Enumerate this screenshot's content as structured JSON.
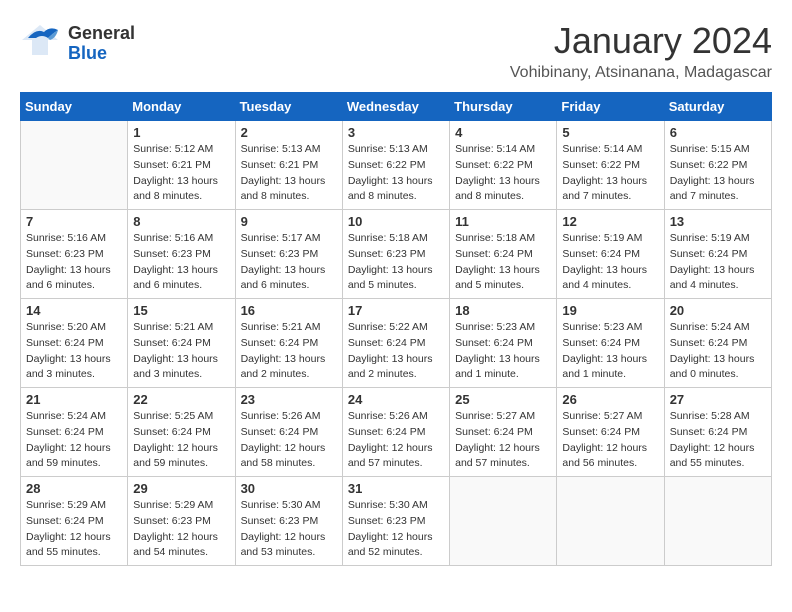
{
  "header": {
    "logo_general": "General",
    "logo_blue": "Blue",
    "month_year": "January 2024",
    "location": "Vohibinany, Atsinanana, Madagascar"
  },
  "weekdays": [
    "Sunday",
    "Monday",
    "Tuesday",
    "Wednesday",
    "Thursday",
    "Friday",
    "Saturday"
  ],
  "weeks": [
    [
      {
        "day": "",
        "info": ""
      },
      {
        "day": "1",
        "info": "Sunrise: 5:12 AM\nSunset: 6:21 PM\nDaylight: 13 hours\nand 8 minutes."
      },
      {
        "day": "2",
        "info": "Sunrise: 5:13 AM\nSunset: 6:21 PM\nDaylight: 13 hours\nand 8 minutes."
      },
      {
        "day": "3",
        "info": "Sunrise: 5:13 AM\nSunset: 6:22 PM\nDaylight: 13 hours\nand 8 minutes."
      },
      {
        "day": "4",
        "info": "Sunrise: 5:14 AM\nSunset: 6:22 PM\nDaylight: 13 hours\nand 8 minutes."
      },
      {
        "day": "5",
        "info": "Sunrise: 5:14 AM\nSunset: 6:22 PM\nDaylight: 13 hours\nand 7 minutes."
      },
      {
        "day": "6",
        "info": "Sunrise: 5:15 AM\nSunset: 6:22 PM\nDaylight: 13 hours\nand 7 minutes."
      }
    ],
    [
      {
        "day": "7",
        "info": "Sunrise: 5:16 AM\nSunset: 6:23 PM\nDaylight: 13 hours\nand 6 minutes."
      },
      {
        "day": "8",
        "info": "Sunrise: 5:16 AM\nSunset: 6:23 PM\nDaylight: 13 hours\nand 6 minutes."
      },
      {
        "day": "9",
        "info": "Sunrise: 5:17 AM\nSunset: 6:23 PM\nDaylight: 13 hours\nand 6 minutes."
      },
      {
        "day": "10",
        "info": "Sunrise: 5:18 AM\nSunset: 6:23 PM\nDaylight: 13 hours\nand 5 minutes."
      },
      {
        "day": "11",
        "info": "Sunrise: 5:18 AM\nSunset: 6:24 PM\nDaylight: 13 hours\nand 5 minutes."
      },
      {
        "day": "12",
        "info": "Sunrise: 5:19 AM\nSunset: 6:24 PM\nDaylight: 13 hours\nand 4 minutes."
      },
      {
        "day": "13",
        "info": "Sunrise: 5:19 AM\nSunset: 6:24 PM\nDaylight: 13 hours\nand 4 minutes."
      }
    ],
    [
      {
        "day": "14",
        "info": "Sunrise: 5:20 AM\nSunset: 6:24 PM\nDaylight: 13 hours\nand 3 minutes."
      },
      {
        "day": "15",
        "info": "Sunrise: 5:21 AM\nSunset: 6:24 PM\nDaylight: 13 hours\nand 3 minutes."
      },
      {
        "day": "16",
        "info": "Sunrise: 5:21 AM\nSunset: 6:24 PM\nDaylight: 13 hours\nand 2 minutes."
      },
      {
        "day": "17",
        "info": "Sunrise: 5:22 AM\nSunset: 6:24 PM\nDaylight: 13 hours\nand 2 minutes."
      },
      {
        "day": "18",
        "info": "Sunrise: 5:23 AM\nSunset: 6:24 PM\nDaylight: 13 hours\nand 1 minute."
      },
      {
        "day": "19",
        "info": "Sunrise: 5:23 AM\nSunset: 6:24 PM\nDaylight: 13 hours\nand 1 minute."
      },
      {
        "day": "20",
        "info": "Sunrise: 5:24 AM\nSunset: 6:24 PM\nDaylight: 13 hours\nand 0 minutes."
      }
    ],
    [
      {
        "day": "21",
        "info": "Sunrise: 5:24 AM\nSunset: 6:24 PM\nDaylight: 12 hours\nand 59 minutes."
      },
      {
        "day": "22",
        "info": "Sunrise: 5:25 AM\nSunset: 6:24 PM\nDaylight: 12 hours\nand 59 minutes."
      },
      {
        "day": "23",
        "info": "Sunrise: 5:26 AM\nSunset: 6:24 PM\nDaylight: 12 hours\nand 58 minutes."
      },
      {
        "day": "24",
        "info": "Sunrise: 5:26 AM\nSunset: 6:24 PM\nDaylight: 12 hours\nand 57 minutes."
      },
      {
        "day": "25",
        "info": "Sunrise: 5:27 AM\nSunset: 6:24 PM\nDaylight: 12 hours\nand 57 minutes."
      },
      {
        "day": "26",
        "info": "Sunrise: 5:27 AM\nSunset: 6:24 PM\nDaylight: 12 hours\nand 56 minutes."
      },
      {
        "day": "27",
        "info": "Sunrise: 5:28 AM\nSunset: 6:24 PM\nDaylight: 12 hours\nand 55 minutes."
      }
    ],
    [
      {
        "day": "28",
        "info": "Sunrise: 5:29 AM\nSunset: 6:24 PM\nDaylight: 12 hours\nand 55 minutes."
      },
      {
        "day": "29",
        "info": "Sunrise: 5:29 AM\nSunset: 6:23 PM\nDaylight: 12 hours\nand 54 minutes."
      },
      {
        "day": "30",
        "info": "Sunrise: 5:30 AM\nSunset: 6:23 PM\nDaylight: 12 hours\nand 53 minutes."
      },
      {
        "day": "31",
        "info": "Sunrise: 5:30 AM\nSunset: 6:23 PM\nDaylight: 12 hours\nand 52 minutes."
      },
      {
        "day": "",
        "info": ""
      },
      {
        "day": "",
        "info": ""
      },
      {
        "day": "",
        "info": ""
      }
    ]
  ]
}
